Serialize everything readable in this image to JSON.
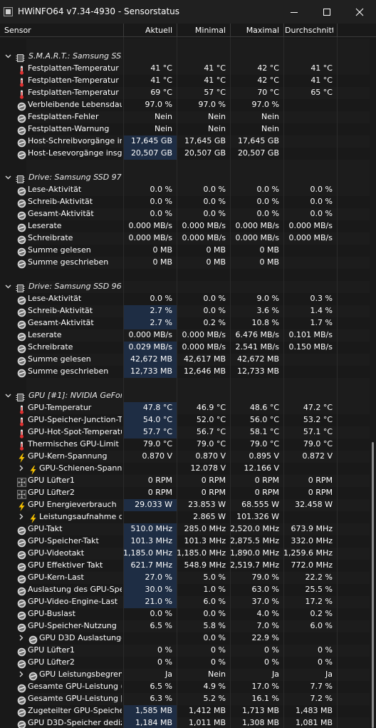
{
  "window": {
    "title": "HWiNFO64 v7.34-4930 - Sensorstatus",
    "buttons": [
      "minimize",
      "maximize",
      "close"
    ]
  },
  "columns": [
    "Sensor",
    "Aktuell",
    "Minimal",
    "Maximal",
    "Durchschnitt"
  ],
  "colors": {
    "background": "#191919",
    "row_alt": "#1c1c1c",
    "highlight": "#1e2d44",
    "text": "#ffffff",
    "thermo_red": "#e03030",
    "bolt_yellow": "#f5c000"
  },
  "rows": [
    {
      "type": "blank"
    },
    {
      "type": "group",
      "label": "S.M.A.R.T.: Samsung SS...",
      "icon": "chip-icon"
    },
    {
      "type": "sensor",
      "label": "Festplatten-Temperatur",
      "icon": "thermometer-icon",
      "values": [
        "41 °C",
        "41 °C",
        "42 °C",
        "41 °C"
      ]
    },
    {
      "type": "sensor",
      "label": "Festplatten-Temperatur 2",
      "icon": "thermometer-icon",
      "values": [
        "41 °C",
        "41 °C",
        "42 °C",
        "41 °C"
      ]
    },
    {
      "type": "sensor",
      "label": "Festplatten-Temperatur 3",
      "icon": "thermometer-icon",
      "values": [
        "69 °C",
        "57 °C",
        "70 °C",
        "65 °C"
      ]
    },
    {
      "type": "sensor",
      "label": "Verbleibende Lebensdau...",
      "icon": "gauge-icon",
      "values": [
        "97.0 %",
        "97.0 %",
        "97.0 %",
        ""
      ]
    },
    {
      "type": "sensor",
      "label": "Festplatten-Fehler",
      "icon": "gauge-icon",
      "values": [
        "Nein",
        "Nein",
        "Nein",
        ""
      ]
    },
    {
      "type": "sensor",
      "label": "Festplatten-Warnung",
      "icon": "gauge-icon",
      "values": [
        "Nein",
        "Nein",
        "Nein",
        ""
      ]
    },
    {
      "type": "sensor",
      "label": "Host-Schreibvorgänge in...",
      "icon": "gauge-icon",
      "highlight": true,
      "values": [
        "17,645 GB",
        "17,645 GB",
        "17,645 GB",
        ""
      ]
    },
    {
      "type": "sensor",
      "label": "Host-Lesevorgänge insg...",
      "icon": "gauge-icon",
      "highlight": true,
      "values": [
        "20,507 GB",
        "20,507 GB",
        "20,507 GB",
        ""
      ]
    },
    {
      "type": "blank"
    },
    {
      "type": "group",
      "label": "Drive: Samsung SSD 970...",
      "icon": "chip-icon"
    },
    {
      "type": "sensor",
      "label": "Lese-Aktivität",
      "icon": "gauge-icon",
      "values": [
        "0.0 %",
        "0.0 %",
        "0.0 %",
        "0.0 %"
      ]
    },
    {
      "type": "sensor",
      "label": "Schreib-Aktivität",
      "icon": "gauge-icon",
      "values": [
        "0.0 %",
        "0.0 %",
        "0.0 %",
        "0.0 %"
      ]
    },
    {
      "type": "sensor",
      "label": "Gesamt-Aktivität",
      "icon": "gauge-icon",
      "values": [
        "0.0 %",
        "0.0 %",
        "0.0 %",
        "0.0 %"
      ]
    },
    {
      "type": "sensor",
      "label": "Leserate",
      "icon": "gauge-icon",
      "values": [
        "0.000 MB/s",
        "0.000 MB/s",
        "0.000 MB/s",
        "0.000 MB/s"
      ]
    },
    {
      "type": "sensor",
      "label": "Schreibrate",
      "icon": "gauge-icon",
      "values": [
        "0.000 MB/s",
        "0.000 MB/s",
        "0.000 MB/s",
        "0.000 MB/s"
      ]
    },
    {
      "type": "sensor",
      "label": "Summe gelesen",
      "icon": "gauge-icon",
      "values": [
        "0 MB",
        "0 MB",
        "0 MB",
        ""
      ]
    },
    {
      "type": "sensor",
      "label": "Summe geschrieben",
      "icon": "gauge-icon",
      "values": [
        "0 MB",
        "0 MB",
        "0 MB",
        ""
      ]
    },
    {
      "type": "blank"
    },
    {
      "type": "group",
      "label": "Drive: Samsung SSD 960...",
      "icon": "chip-icon"
    },
    {
      "type": "sensor",
      "label": "Lese-Aktivität",
      "icon": "gauge-icon",
      "values": [
        "0.0 %",
        "0.0 %",
        "9.0 %",
        "0.3 %"
      ]
    },
    {
      "type": "sensor",
      "label": "Schreib-Aktivität",
      "icon": "gauge-icon",
      "highlight": true,
      "values": [
        "2.7 %",
        "0.0 %",
        "3.6 %",
        "1.4 %"
      ]
    },
    {
      "type": "sensor",
      "label": "Gesamt-Aktivität",
      "icon": "gauge-icon",
      "highlight": true,
      "values": [
        "2.7 %",
        "0.2 %",
        "10.8 %",
        "1.7 %"
      ]
    },
    {
      "type": "sensor",
      "label": "Leserate",
      "icon": "gauge-icon",
      "values": [
        "0.000 MB/s",
        "0.000 MB/s",
        "6.476 MB/s",
        "0.101 MB/s"
      ]
    },
    {
      "type": "sensor",
      "label": "Schreibrate",
      "icon": "gauge-icon",
      "highlight": true,
      "values": [
        "0.029 MB/s",
        "0.000 MB/s",
        "2.541 MB/s",
        "0.150 MB/s"
      ]
    },
    {
      "type": "sensor",
      "label": "Summe gelesen",
      "icon": "gauge-icon",
      "highlight": true,
      "values": [
        "42,672 MB",
        "42,617 MB",
        "42,672 MB",
        ""
      ]
    },
    {
      "type": "sensor",
      "label": "Summe geschrieben",
      "icon": "gauge-icon",
      "highlight": true,
      "values": [
        "12,733 MB",
        "12,646 MB",
        "12,733 MB",
        ""
      ]
    },
    {
      "type": "blank"
    },
    {
      "type": "group",
      "label": "GPU [#1]: NVIDIA GeFor...",
      "icon": "chip-icon"
    },
    {
      "type": "sensor",
      "label": "GPU-Temperatur",
      "icon": "thermometer-icon",
      "highlight": true,
      "values": [
        "47.8 °C",
        "46.9 °C",
        "48.6 °C",
        "47.2 °C"
      ]
    },
    {
      "type": "sensor",
      "label": "GPU-Speicher-Junction-T...",
      "icon": "thermometer-icon",
      "highlight": true,
      "values": [
        "54.0 °C",
        "52.0 °C",
        "56.0 °C",
        "53.2 °C"
      ]
    },
    {
      "type": "sensor",
      "label": "GPU-Hot-Spot-Temperatur",
      "icon": "thermometer-icon",
      "highlight": true,
      "values": [
        "57.7 °C",
        "56.7 °C",
        "58.1 °C",
        "57.1 °C"
      ]
    },
    {
      "type": "sensor",
      "label": "Thermisches GPU-Limit",
      "icon": "thermometer-icon",
      "values": [
        "79.0 °C",
        "79.0 °C",
        "79.0 °C",
        "79.0 °C"
      ]
    },
    {
      "type": "sensor",
      "label": "GPU-Kern-Spannung",
      "icon": "bolt-icon",
      "values": [
        "0.870 V",
        "0.870 V",
        "0.895 V",
        "0.872 V"
      ]
    },
    {
      "type": "sensor",
      "label": "GPU-Schienen-Spann...",
      "icon": "bolt-icon",
      "expand": true,
      "values": [
        "",
        "12.078 V",
        "12.166 V",
        ""
      ]
    },
    {
      "type": "sensor",
      "label": "GPU Lüfter1",
      "icon": "fan-icon",
      "values": [
        "0 RPM",
        "0 RPM",
        "0 RPM",
        "0 RPM"
      ]
    },
    {
      "type": "sensor",
      "label": "GPU Lüfter2",
      "icon": "fan-icon",
      "values": [
        "0 RPM",
        "0 RPM",
        "0 RPM",
        "0 RPM"
      ]
    },
    {
      "type": "sensor",
      "label": "GPU Energieverbrauch",
      "icon": "bolt-icon",
      "highlight": true,
      "values": [
        "29.033 W",
        "23.853 W",
        "68.555 W",
        "32.458 W"
      ]
    },
    {
      "type": "sensor",
      "label": "Leistungsaufnahme d...",
      "icon": "bolt-icon",
      "expand": true,
      "values": [
        "",
        "2.865 W",
        "101.326 W",
        ""
      ]
    },
    {
      "type": "sensor",
      "label": "GPU-Takt",
      "icon": "gauge-icon",
      "highlight": true,
      "values": [
        "510.0 MHz",
        "285.0 MHz",
        "2,520.0 MHz",
        "673.9 MHz"
      ]
    },
    {
      "type": "sensor",
      "label": "GPU-Speicher-Takt",
      "icon": "gauge-icon",
      "highlight": true,
      "values": [
        "101.3 MHz",
        "101.3 MHz",
        "2,875.5 MHz",
        "332.0 MHz"
      ]
    },
    {
      "type": "sensor",
      "label": "GPU-Videotakt",
      "icon": "gauge-icon",
      "highlight": true,
      "values": [
        "1,185.0 MHz",
        "1,185.0 MHz",
        "1,890.0 MHz",
        "1,259.6 MHz"
      ]
    },
    {
      "type": "sensor",
      "label": "GPU Effektiver Takt",
      "icon": "gauge-icon",
      "highlight": true,
      "values": [
        "621.7 MHz",
        "548.9 MHz",
        "2,519.7 MHz",
        "772.0 MHz"
      ]
    },
    {
      "type": "sensor",
      "label": "GPU-Kern-Last",
      "icon": "gauge-icon",
      "highlight": true,
      "values": [
        "27.0 %",
        "5.0 %",
        "79.0 %",
        "22.2 %"
      ]
    },
    {
      "type": "sensor",
      "label": "Auslastung des GPU-Spei...",
      "icon": "gauge-icon",
      "highlight": true,
      "values": [
        "30.0 %",
        "1.0 %",
        "63.0 %",
        "25.5 %"
      ]
    },
    {
      "type": "sensor",
      "label": "GPU-Video-Engine-Last",
      "icon": "gauge-icon",
      "highlight": true,
      "values": [
        "21.0 %",
        "6.0 %",
        "37.0 %",
        "17.2 %"
      ]
    },
    {
      "type": "sensor",
      "label": "GPU-Buslast",
      "icon": "gauge-icon",
      "values": [
        "0.0 %",
        "0.0 %",
        "4.0 %",
        "0.2 %"
      ]
    },
    {
      "type": "sensor",
      "label": "GPU-Speicher-Nutzung",
      "icon": "gauge-icon",
      "values": [
        "6.5 %",
        "5.8 %",
        "7.0 %",
        "6.0 %"
      ]
    },
    {
      "type": "sensor",
      "label": "GPU D3D Auslastungen",
      "icon": "gauge-icon",
      "expand": true,
      "values": [
        "",
        "0.0 %",
        "22.9 %",
        ""
      ]
    },
    {
      "type": "sensor",
      "label": "GPU Lüfter1",
      "icon": "gauge-icon",
      "values": [
        "0 %",
        "0 %",
        "0 %",
        "0 %"
      ]
    },
    {
      "type": "sensor",
      "label": "GPU Lüfter2",
      "icon": "gauge-icon",
      "values": [
        "0 %",
        "0 %",
        "0 %",
        "0 %"
      ]
    },
    {
      "type": "sensor",
      "label": "GPU Leistungsbegren...",
      "icon": "gauge-icon",
      "expand": true,
      "values": [
        "Ja",
        "Nein",
        "Ja",
        "Ja"
      ]
    },
    {
      "type": "sensor",
      "label": "Gesamte GPU-Leistung (...",
      "icon": "gauge-icon",
      "values": [
        "6.5 %",
        "4.9 %",
        "17.0 %",
        "7.7 %"
      ]
    },
    {
      "type": "sensor",
      "label": "Gesamte GPU-Leistung [...",
      "icon": "gauge-icon",
      "values": [
        "6.3 %",
        "5.2 %",
        "16.1 %",
        "7.2 %"
      ]
    },
    {
      "type": "sensor",
      "label": "Zugeteilter GPU-Speicher",
      "icon": "gauge-icon",
      "highlight": true,
      "values": [
        "1,585 MB",
        "1,412 MB",
        "1,713 MB",
        "1,483 MB"
      ]
    },
    {
      "type": "sensor",
      "label": "GPU D3D-Speicher dediz...",
      "icon": "gauge-icon",
      "highlight": true,
      "values": [
        "1,184 MB",
        "1,011 MB",
        "1,308 MB",
        "1,081 MB"
      ]
    }
  ]
}
